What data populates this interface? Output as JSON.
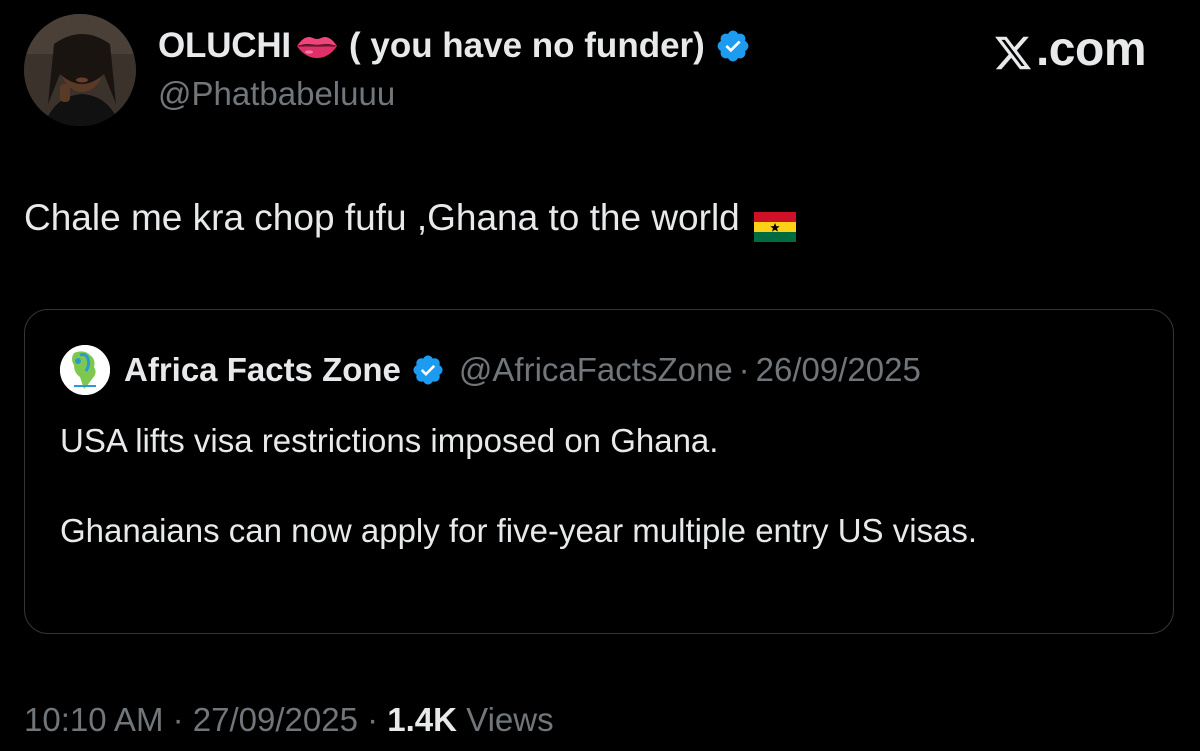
{
  "brand": {
    "label": ".com"
  },
  "author": {
    "name": "OLUCHI",
    "tagline": "( you have no funder)",
    "handle": "@Phatbabeluuu",
    "verified": true
  },
  "tweet": {
    "text": "Chale me kra chop fufu ,Ghana to the world"
  },
  "quote": {
    "name": "Africa Facts Zone",
    "verified": true,
    "handle": "@AfricaFactsZone",
    "separator": "·",
    "date": "26/09/2025",
    "paragraphs": [
      "USA lifts visa restrictions imposed on Ghana.",
      "Ghanaians can now apply for five-year multiple entry US visas."
    ]
  },
  "meta": {
    "time": "10:10 AM",
    "separator1": " · ",
    "date": "27/09/2025",
    "separator2": " · ",
    "views_count": "1.4K",
    "views_label": " Views"
  },
  "colors": {
    "background": "#000000",
    "primary_text": "#e7e9ea",
    "secondary_text": "#71767b",
    "verified_blue": "#1d9bf0",
    "border": "#333639"
  },
  "icons": {
    "lips": "lips-emoji-icon",
    "verified": "verified-badge-icon",
    "flag": "ghana-flag-icon",
    "brand": "x-logo-icon"
  }
}
